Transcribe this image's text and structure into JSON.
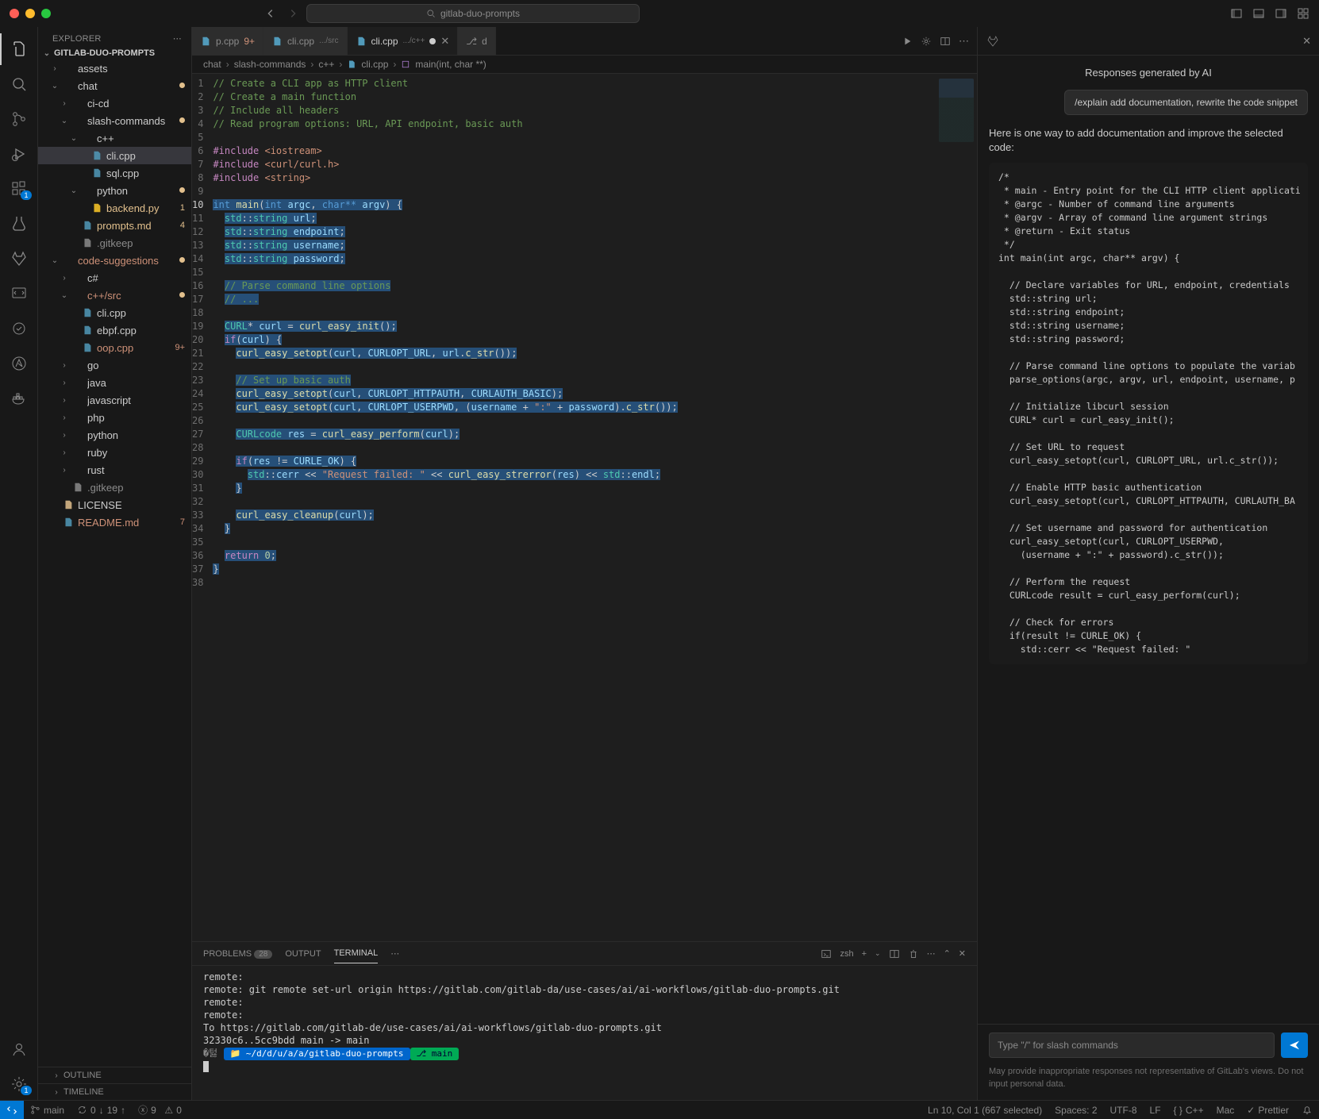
{
  "titlebar": {
    "search": "gitlab-duo-prompts"
  },
  "sidebar": {
    "title": "EXPLORER",
    "root": "GITLAB-DUO-PROMPTS",
    "outline": "OUTLINE",
    "timeline": "TIMELINE",
    "tree": [
      {
        "d": 1,
        "t": "folder",
        "open": false,
        "name": "assets"
      },
      {
        "d": 1,
        "t": "folder",
        "open": true,
        "name": "chat",
        "deco": "dot",
        "color": "#e2c08d"
      },
      {
        "d": 2,
        "t": "folder",
        "open": false,
        "name": "ci-cd"
      },
      {
        "d": 2,
        "t": "folder",
        "open": true,
        "name": "slash-commands",
        "deco": "dot",
        "color": "#e2c08d"
      },
      {
        "d": 3,
        "t": "folder",
        "open": true,
        "name": "c++"
      },
      {
        "d": 4,
        "t": "file",
        "icon": "cpp",
        "name": "cli.cpp",
        "sel": true
      },
      {
        "d": 4,
        "t": "file",
        "icon": "cpp",
        "name": "sql.cpp"
      },
      {
        "d": 3,
        "t": "folder",
        "open": true,
        "name": "python",
        "deco": "dot",
        "color": "#e2c08d"
      },
      {
        "d": 4,
        "t": "file",
        "icon": "py",
        "name": "backend.py",
        "deco": "1",
        "color": "#e2c08d",
        "textcol": "#e2c08d"
      },
      {
        "d": 3,
        "t": "file",
        "icon": "md",
        "name": "prompts.md",
        "deco": "4",
        "color": "#e2c08d",
        "textcol": "#e2c08d"
      },
      {
        "d": 3,
        "t": "file",
        "icon": "txt",
        "name": ".gitkeep",
        "textcol": "#8b8b8b"
      },
      {
        "d": 1,
        "t": "folder",
        "open": true,
        "name": "code-suggestions",
        "deco": "dot",
        "color": "#e2c08d",
        "textcol": "#ce9178"
      },
      {
        "d": 2,
        "t": "folder",
        "open": false,
        "name": "c#"
      },
      {
        "d": 2,
        "t": "folder",
        "open": true,
        "name": "c++/src",
        "deco": "dot",
        "color": "#e2c08d",
        "textcol": "#ce9178"
      },
      {
        "d": 3,
        "t": "file",
        "icon": "cpp",
        "name": "cli.cpp"
      },
      {
        "d": 3,
        "t": "file",
        "icon": "cpp",
        "name": "ebpf.cpp"
      },
      {
        "d": 3,
        "t": "file",
        "icon": "cpp",
        "name": "oop.cpp",
        "deco": "9+",
        "color": "#ce9178",
        "textcol": "#ce9178"
      },
      {
        "d": 2,
        "t": "folder",
        "open": false,
        "name": "go"
      },
      {
        "d": 2,
        "t": "folder",
        "open": false,
        "name": "java"
      },
      {
        "d": 2,
        "t": "folder",
        "open": false,
        "name": "javascript"
      },
      {
        "d": 2,
        "t": "folder",
        "open": false,
        "name": "php"
      },
      {
        "d": 2,
        "t": "folder",
        "open": false,
        "name": "python"
      },
      {
        "d": 2,
        "t": "folder",
        "open": false,
        "name": "ruby"
      },
      {
        "d": 2,
        "t": "folder",
        "open": false,
        "name": "rust"
      },
      {
        "d": 2,
        "t": "file",
        "icon": "txt",
        "name": ".gitkeep",
        "textcol": "#8b8b8b"
      },
      {
        "d": 1,
        "t": "file",
        "icon": "lic",
        "name": "LICENSE"
      },
      {
        "d": 1,
        "t": "file",
        "icon": "info",
        "name": "README.md",
        "deco": "7",
        "color": "#ce9178",
        "textcol": "#ce9178"
      }
    ]
  },
  "tabs": [
    {
      "label": "p.cpp",
      "suffix": "9+",
      "suffixColor": "#ce9178",
      "active": false
    },
    {
      "label": "cli.cpp",
      "path": ".../src",
      "active": false
    },
    {
      "label": "cli.cpp",
      "path": ".../c++",
      "active": true,
      "dirty": true
    },
    {
      "label": "d",
      "git": true,
      "active": false
    }
  ],
  "breadcrumb": [
    "chat",
    "slash-commands",
    "c++",
    "cli.cpp",
    "main(int, char **)"
  ],
  "code": {
    "lines": [
      {
        "n": 1,
        "html": "<span class='c-cmt'>// Create a CLI app as HTTP client</span>"
      },
      {
        "n": 2,
        "html": "<span class='c-cmt'>// Create a main function</span>"
      },
      {
        "n": 3,
        "html": "<span class='c-cmt'>// Include all headers</span>"
      },
      {
        "n": 4,
        "html": "<span class='c-cmt'>// Read program options: URL, API endpoint, basic auth</span>"
      },
      {
        "n": 5,
        "html": ""
      },
      {
        "n": 6,
        "html": "<span class='c-mac'>#include</span> <span class='c-str'>&lt;iostream&gt;</span>"
      },
      {
        "n": 7,
        "html": "<span class='c-mac'>#include</span> <span class='c-str'>&lt;curl/curl.h&gt;</span>"
      },
      {
        "n": 8,
        "html": "<span class='c-mac'>#include</span> <span class='c-str'>&lt;string&gt;</span>"
      },
      {
        "n": 9,
        "html": ""
      },
      {
        "n": 10,
        "cur": true,
        "html": "<span class='hl'><span class='c-kw'>int</span> <span class='c-fn'>main</span>(<span class='c-kw'>int</span> <span class='c-var'>argc</span>, <span class='c-kw'>char**</span> <span class='c-var'>argv</span>) {</span>"
      },
      {
        "n": 11,
        "html": "  <span class='hl'><span class='c-ty'>std</span>::<span class='c-ty'>string</span> <span class='c-var'>url</span>;</span>"
      },
      {
        "n": 12,
        "html": "  <span class='hl'><span class='c-ty'>std</span>::<span class='c-ty'>string</span> <span class='c-var'>endpoint</span>;</span>"
      },
      {
        "n": 13,
        "html": "  <span class='hl'><span class='c-ty'>std</span>::<span class='c-ty'>string</span> <span class='c-var'>username</span>;</span>"
      },
      {
        "n": 14,
        "html": "  <span class='hl'><span class='c-ty'>std</span>::<span class='c-ty'>string</span> <span class='c-var'>password</span>;</span>"
      },
      {
        "n": 15,
        "html": ""
      },
      {
        "n": 16,
        "html": "  <span class='hl c-cmt'>// Parse command line options</span>"
      },
      {
        "n": 17,
        "html": "  <span class='hl c-cmt'>// ...</span>"
      },
      {
        "n": 18,
        "html": ""
      },
      {
        "n": 19,
        "html": "  <span class='hl'><span class='c-ty'>CURL</span>* <span class='c-var'>curl</span> = <span class='c-fn'>curl_easy_init</span>();</span>"
      },
      {
        "n": 20,
        "html": "  <span class='hl'><span class='c-mac'>if</span>(<span class='c-var'>curl</span>) {</span>"
      },
      {
        "n": 21,
        "html": "    <span class='hl'><span class='c-fn'>curl_easy_setopt</span>(<span class='c-var'>curl</span>, <span class='c-var'>CURLOPT_URL</span>, <span class='c-var'>url</span>.<span class='c-fn'>c_str</span>());</span>"
      },
      {
        "n": 22,
        "html": ""
      },
      {
        "n": 23,
        "html": "    <span class='hl c-cmt'>// Set up basic auth</span>"
      },
      {
        "n": 24,
        "html": "    <span class='hl'><span class='c-fn'>curl_easy_setopt</span>(<span class='c-var'>curl</span>, <span class='c-var'>CURLOPT_HTTPAUTH</span>, <span class='c-var'>CURLAUTH_BASIC</span>);</span>"
      },
      {
        "n": 25,
        "html": "    <span class='hl'><span class='c-fn'>curl_easy_setopt</span>(<span class='c-var'>curl</span>, <span class='c-var'>CURLOPT_USERPWD</span>, (<span class='c-var'>username</span> + <span class='c-str'>\":\"</span> + <span class='c-var'>password</span>).<span class='c-fn'>c_str</span>());</span>"
      },
      {
        "n": 26,
        "html": ""
      },
      {
        "n": 27,
        "html": "    <span class='hl'><span class='c-ty'>CURLcode</span> <span class='c-var'>res</span> = <span class='c-fn'>curl_easy_perform</span>(<span class='c-var'>curl</span>);</span>"
      },
      {
        "n": 28,
        "html": ""
      },
      {
        "n": 29,
        "html": "    <span class='hl'><span class='c-mac'>if</span>(<span class='c-var'>res</span> != <span class='c-var'>CURLE_OK</span>) {</span>"
      },
      {
        "n": 30,
        "html": "      <span class='hl'><span class='c-ty'>std</span>::<span class='c-var'>cerr</span> &lt;&lt; <span class='c-str'>\"Request failed: \"</span> &lt;&lt; <span class='c-fn'>curl_easy_strerror</span>(<span class='c-var'>res</span>) &lt;&lt; <span class='c-ty'>std</span>::<span class='c-var'>endl</span>;</span>"
      },
      {
        "n": 31,
        "html": "    <span class='hl'>}</span>"
      },
      {
        "n": 32,
        "html": ""
      },
      {
        "n": 33,
        "html": "    <span class='hl'><span class='c-fn'>curl_easy_cleanup</span>(<span class='c-var'>curl</span>);</span>"
      },
      {
        "n": 34,
        "html": "  <span class='hl'>}</span>"
      },
      {
        "n": 35,
        "html": ""
      },
      {
        "n": 36,
        "html": "  <span class='hl'><span class='c-mac'>return</span> <span class='c-num'>0</span>;</span>"
      },
      {
        "n": 37,
        "html": "<span class='hl'>}</span>"
      },
      {
        "n": 38,
        "html": ""
      }
    ]
  },
  "panel": {
    "tabs": {
      "problems": "PROBLEMS",
      "problems_count": "28",
      "output": "OUTPUT",
      "terminal": "TERMINAL"
    },
    "shell": "zsh",
    "lines": [
      "remote:",
      "remote:   git remote set-url origin https://gitlab.com/gitlab-da/use-cases/ai/ai-workflows/gitlab-duo-prompts.git",
      "remote:",
      "remote:",
      "To https://gitlab.com/gitlab-de/use-cases/ai/ai-workflows/gitlab-duo-prompts.git",
      "   32330c6..5cc9bdd  main -> main"
    ],
    "prompt_path": "~/d/d/u/a/a/gitlab-duo-prompts",
    "prompt_branch": "main"
  },
  "ai": {
    "header": "Responses generated by AI",
    "chip": "/explain add documentation, rewrite the code snippet",
    "intro": "Here is one way to add documentation and improve the selected code:",
    "code": "/*\n * main - Entry point for the CLI HTTP client applicati\n * @argc - Number of command line arguments\n * @argv - Array of command line argument strings\n * @return - Exit status\n */\nint main(int argc, char** argv) {\n\n  // Declare variables for URL, endpoint, credentials\n  std::string url;\n  std::string endpoint;\n  std::string username;\n  std::string password;\n\n  // Parse command line options to populate the variab\n  parse_options(argc, argv, url, endpoint, username, p\n\n  // Initialize libcurl session\n  CURL* curl = curl_easy_init();\n\n  // Set URL to request\n  curl_easy_setopt(curl, CURLOPT_URL, url.c_str());\n\n  // Enable HTTP basic authentication\n  curl_easy_setopt(curl, CURLOPT_HTTPAUTH, CURLAUTH_BA\n\n  // Set username and password for authentication\n  curl_easy_setopt(curl, CURLOPT_USERPWD,\n    (username + \":\" + password).c_str());\n\n  // Perform the request\n  CURLcode result = curl_easy_perform(curl);\n\n  // Check for errors\n  if(result != CURLE_OK) {\n    std::cerr << \"Request failed: \"",
    "placeholder": "Type \"/\" for slash commands",
    "disclaimer": "May provide inappropriate responses not representative of GitLab's views. Do not input personal data."
  },
  "status": {
    "branch": "main",
    "sync_down": "0",
    "sync_up": "19",
    "errors": "9",
    "warnings": "0",
    "cursor": "Ln 10, Col 1 (667 selected)",
    "spaces": "Spaces: 2",
    "enc": "UTF-8",
    "eol": "LF",
    "lang": "C++",
    "os": "Mac",
    "formatter": "Prettier"
  }
}
